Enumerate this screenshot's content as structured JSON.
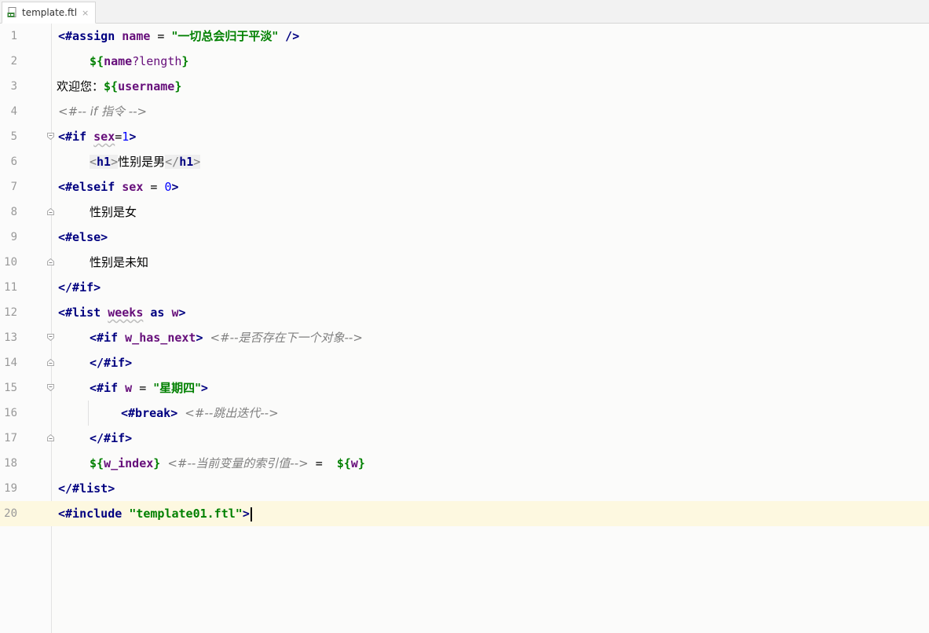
{
  "tab": {
    "file_name": "template.ftl",
    "close_glyph": "×"
  },
  "editor": {
    "line_numbers": [
      "1",
      "2",
      "3",
      "4",
      "5",
      "6",
      "7",
      "8",
      "9",
      "10",
      "11",
      "12",
      "13",
      "14",
      "15",
      "16",
      "17",
      "18",
      "19",
      "20"
    ],
    "current_line": 20,
    "lines": {
      "l1": {
        "open": "<#assign",
        "name": "name",
        "eq": " = ",
        "value": "\"一切总会归于平淡\"",
        "close": " />"
      },
      "l2": {
        "open": "${",
        "name": "name",
        "builtin": "?length",
        "close": "}"
      },
      "l3": {
        "text": "欢迎您：",
        "open": "${",
        "name": "username",
        "close": "}"
      },
      "l4": {
        "comment": "<#-- if 指令 -->"
      },
      "l5": {
        "open": "<#if",
        "name": "sex",
        "op": "=",
        "num": "1",
        "close": ">"
      },
      "l6": {
        "tag_open": "<",
        "tag_name": "h1",
        "tag_gt": ">",
        "text": "性别是男",
        "end_open": "</",
        "end_name": "h1",
        "end_gt": ">"
      },
      "l7": {
        "open": "<#elseif",
        "name": "sex",
        "op": " = ",
        "num": "0",
        "close": ">"
      },
      "l8": {
        "text": "性别是女"
      },
      "l9": {
        "open": "<#else>"
      },
      "l10": {
        "text": "性别是未知"
      },
      "l11": {
        "open": "</#if>"
      },
      "l12": {
        "open": "<#list",
        "name": "weeks",
        "as": " as ",
        "alias": "w",
        "close": ">"
      },
      "l13": {
        "open": "<#if",
        "name": "w_has_next",
        "close": ">",
        "comment": "<#--是否存在下一个对象-->"
      },
      "l14": {
        "open": "</#if>"
      },
      "l15": {
        "open": "<#if",
        "name": "w",
        "op": " = ",
        "value": "\"星期四\"",
        "close": ">"
      },
      "l16": {
        "open": "<#break>",
        "comment": "<#--跳出迭代-->"
      },
      "l17": {
        "open": "</#if>"
      },
      "l18": {
        "open": "${",
        "name": "w_index",
        "close": "}",
        "comment": "<#--当前变量的索引值-->",
        "eq": " =  ",
        "open2": "${",
        "name2": "w",
        "close2": "}"
      },
      "l19": {
        "open": "</#list>"
      },
      "l20": {
        "open": "<#include",
        "value": "\"template01.ftl\"",
        "close": ">"
      }
    }
  }
}
